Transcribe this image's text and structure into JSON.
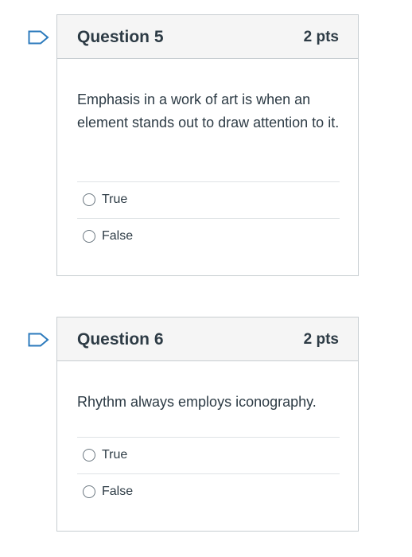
{
  "questions": [
    {
      "title": "Question 5",
      "points": "2 pts",
      "text": "Emphasis in a work of art is when an element stands out to draw attention to it.",
      "flag_icon": "bookmark-flag-icon",
      "answers": [
        {
          "label": "True",
          "selected": false
        },
        {
          "label": "False",
          "selected": false
        }
      ]
    },
    {
      "title": "Question 6",
      "points": "2 pts",
      "text": "Rhythm always employs iconography.",
      "flag_icon": "bookmark-flag-icon",
      "answers": [
        {
          "label": "True",
          "selected": false
        },
        {
          "label": "False",
          "selected": false
        }
      ]
    }
  ],
  "colors": {
    "flag_outline": "#2b7abc",
    "header_bg": "#f5f5f5",
    "border": "#c7cdd1",
    "text": "#2d3b45"
  }
}
